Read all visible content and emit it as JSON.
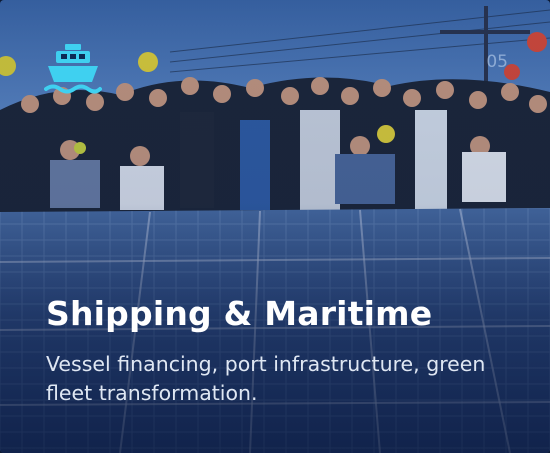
{
  "card": {
    "icon": "ship-icon",
    "number": "05",
    "title": "Shipping & Maritime",
    "description": "Vessel financing, port infrastructure, green fleet transformation."
  },
  "colors": {
    "icon": "#3fd0f0",
    "title": "#ffffff",
    "overlay": "#0a1c46",
    "sky": "#4a78b8",
    "panels": "#2a4c8c"
  }
}
